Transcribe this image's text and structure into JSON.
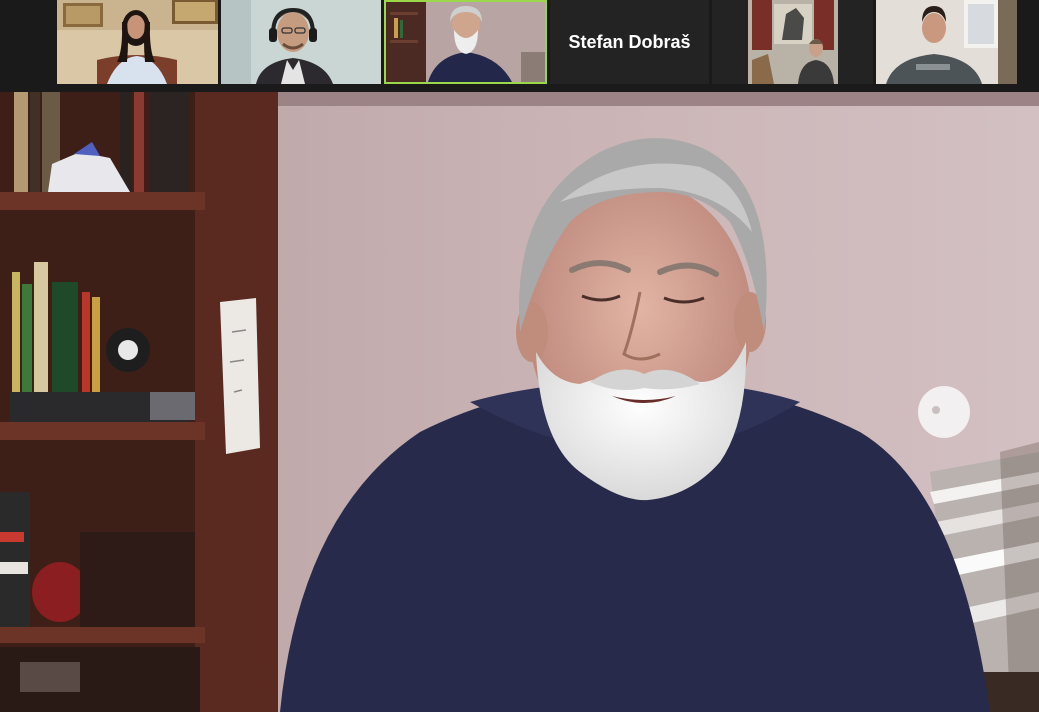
{
  "meeting": {
    "view": "speaker",
    "participants": [
      {
        "id": "p1",
        "name": "",
        "video": true
      },
      {
        "id": "p2",
        "name": "",
        "video": true
      },
      {
        "id": "p3",
        "name": "",
        "video": true,
        "active_speaker": true
      },
      {
        "id": "p4",
        "name": "Stefan Dobraš",
        "video": false
      },
      {
        "id": "p5",
        "name": "",
        "video": true
      },
      {
        "id": "p6",
        "name": "",
        "video": true
      }
    ],
    "colors": {
      "strip_bg": "#1a1a1a",
      "tile_bg": "#232323",
      "active_border": "#9ad84a",
      "name_text": "#ffffff"
    }
  }
}
